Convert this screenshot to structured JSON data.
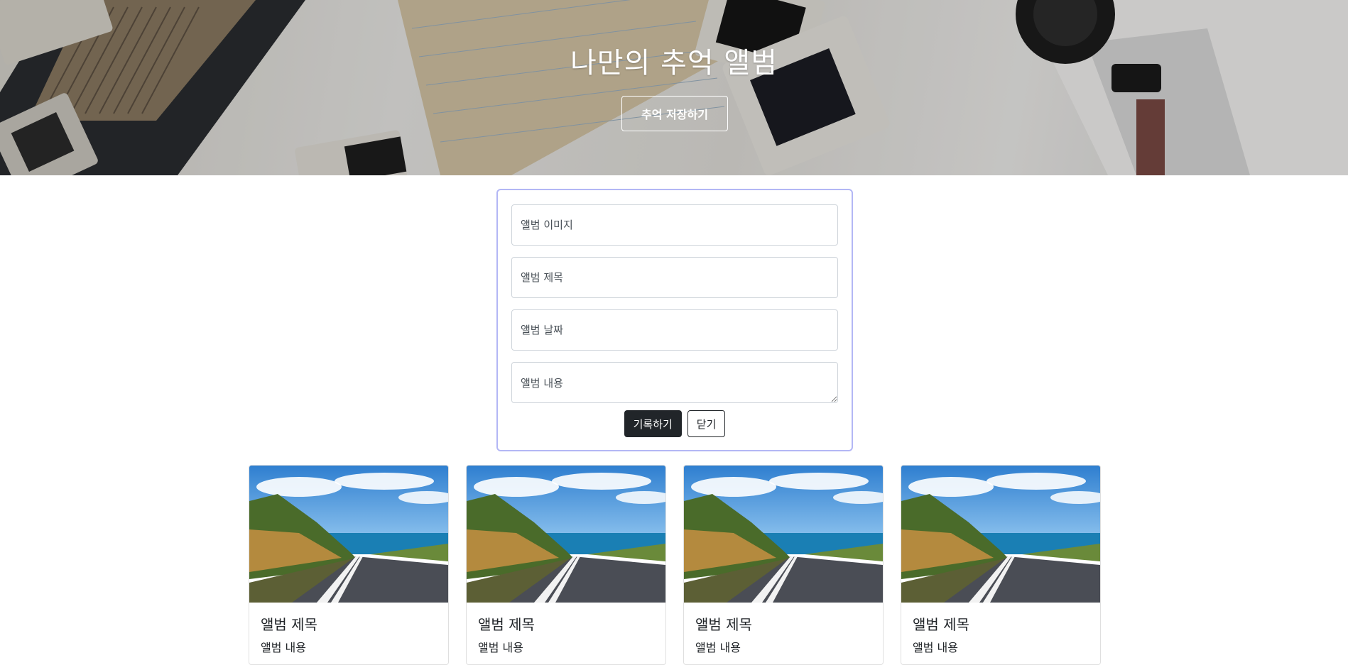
{
  "hero": {
    "title": "나만의 추억 앨범",
    "save_button": "추억 저장하기"
  },
  "form": {
    "image_placeholder": "앨범 이미지",
    "title_placeholder": "앨범 제목",
    "date_placeholder": "앨범 날짜",
    "content_placeholder": "앨범 내용",
    "submit_label": "기록하기",
    "close_label": "닫기",
    "accent_color": "#b3b7f5"
  },
  "cards": [
    {
      "title": "앨범 제목",
      "text": "앨범 내용",
      "image": "coastal-road-photo"
    },
    {
      "title": "앨범 제목",
      "text": "앨범 내용",
      "image": "coastal-road-photo"
    },
    {
      "title": "앨범 제목",
      "text": "앨범 내용",
      "image": "coastal-road-photo"
    },
    {
      "title": "앨범 제목",
      "text": "앨범 내용",
      "image": "coastal-road-photo"
    }
  ]
}
